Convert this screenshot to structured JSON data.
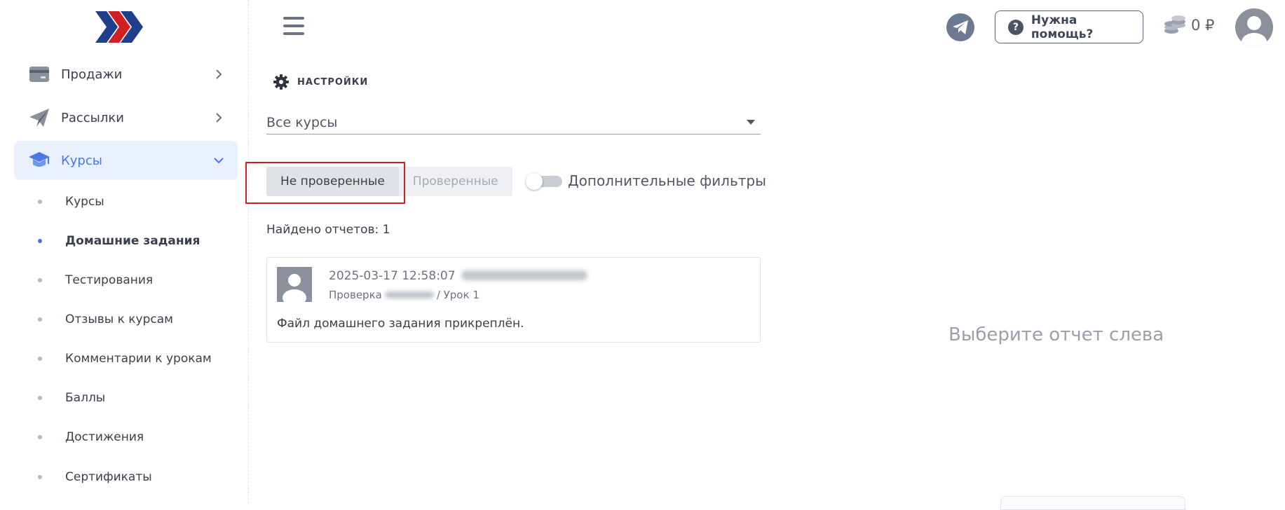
{
  "sidebar": {
    "items": [
      {
        "label": "Продажи",
        "icon": "card-icon"
      },
      {
        "label": "Рассылки",
        "icon": "paper-plane-icon"
      },
      {
        "label": "Курсы",
        "icon": "graduation-cap-icon"
      }
    ],
    "subitems": [
      {
        "label": "Курсы"
      },
      {
        "label": "Домашние задания"
      },
      {
        "label": "Тестирования"
      },
      {
        "label": "Отзывы к курсам"
      },
      {
        "label": "Комментарии к урокам"
      },
      {
        "label": "Баллы"
      },
      {
        "label": "Достижения"
      },
      {
        "label": "Сертификаты"
      }
    ]
  },
  "header": {
    "help_label": "Нужна помощь?",
    "help_icon_glyph": "?",
    "balance": "0 ₽"
  },
  "main": {
    "settings_label": "НАСТРОЙКИ",
    "course_select": "Все курсы",
    "tabs": [
      {
        "label": "Не проверенные"
      },
      {
        "label": "Проверенные"
      }
    ],
    "filters_label": "Дополнительные фильтры",
    "found_text": "Найдено отчетов: 1",
    "report": {
      "datetime": "2025-03-17 12:58:07",
      "check_prefix": "Проверка",
      "lesson": "/ Урок 1",
      "message": "Файл домашнего задания прикреплён."
    },
    "placeholder": "Выберите отчет слева"
  },
  "colors": {
    "accent": "#4a78e4",
    "active_bg": "#e9f0fe",
    "highlight": "#d21f26",
    "logo_blue": "#1f3f8a",
    "logo_red": "#d21f26"
  }
}
